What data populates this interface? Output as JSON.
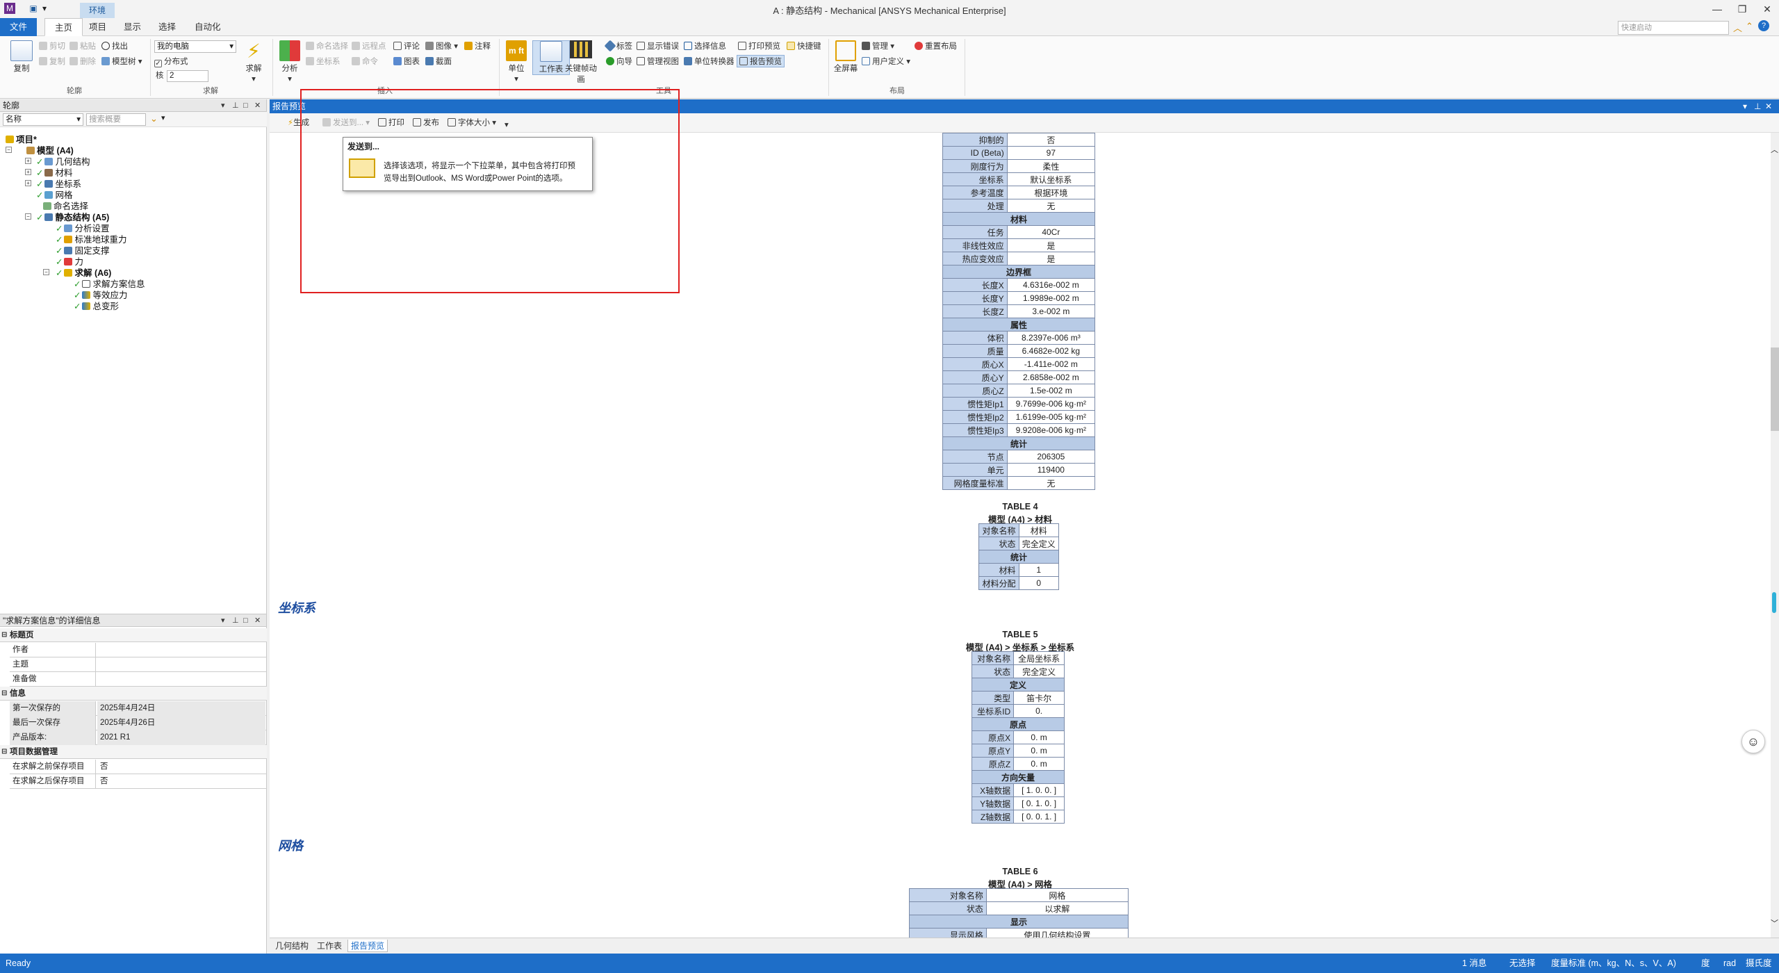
{
  "window": {
    "title": "A : 静态结构 - Mechanical [ANSYS Mechanical Enterprise]"
  },
  "tabs": {
    "env": "环境",
    "file": "文件",
    "items": [
      "主页",
      "项目",
      "显示",
      "选择",
      "自动化"
    ]
  },
  "quick_search": {
    "placeholder": "快速启动"
  },
  "ribbon": {
    "groups": [
      "轮廓",
      "求解",
      "插入",
      "工具",
      "布局"
    ],
    "outline": {
      "copy": "复制",
      "cut": "剪切",
      "paste": "粘贴",
      "find": "找出",
      "duplicate": "复制",
      "delete": "删除",
      "tree": "模型树"
    },
    "solve": {
      "target": "我的电脑",
      "distributed": "分布式",
      "cores_label": "核",
      "cores_value": "2",
      "solve_btn": "求解"
    },
    "insert": {
      "analysis": "分析",
      "named_sel": "命名选择",
      "coord": "坐标系",
      "remote": "远程点",
      "command": "命令",
      "comment": "评论",
      "chart": "图表",
      "image": "图像",
      "section": "截面",
      "annotation": "注释"
    },
    "tools": {
      "units": "单位",
      "worksheet": "工作表",
      "keyframe": "关键帧动画",
      "tag": "标签",
      "wizard": "向导",
      "show_errors": "显示错误",
      "manage_view": "管理视图",
      "sel_info": "选择信息",
      "unit_conv": "单位转换器",
      "print_preview": "打印预览",
      "report_preview": "报告预览",
      "shortcut": "快捷键"
    },
    "layout": {
      "fullscreen": "全屏幕",
      "manage": "管理",
      "user_def": "用户定义",
      "reset": "重置布局"
    }
  },
  "outline": {
    "title": "轮廓",
    "name_filter": "名称",
    "search_placeholder": "搜索概要",
    "tree": [
      {
        "label": "项目*"
      },
      {
        "label": "模型 (A4)"
      },
      {
        "label": "几何结构"
      },
      {
        "label": "材料"
      },
      {
        "label": "坐标系"
      },
      {
        "label": "网格"
      },
      {
        "label": "命名选择"
      },
      {
        "label": "静态结构 (A5)"
      },
      {
        "label": "分析设置"
      },
      {
        "label": "标准地球重力"
      },
      {
        "label": "固定支撑"
      },
      {
        "label": "力"
      },
      {
        "label": "求解 (A6)"
      },
      {
        "label": "求解方案信息"
      },
      {
        "label": "等效应力"
      },
      {
        "label": "总变形"
      }
    ]
  },
  "details": {
    "title": "\"求解方案信息\"的详细信息",
    "sections": [
      {
        "name": "标题页",
        "rows": [
          {
            "k": "作者",
            "v": ""
          },
          {
            "k": "主题",
            "v": ""
          },
          {
            "k": "准备做",
            "v": ""
          }
        ]
      },
      {
        "name": "信息",
        "rows": [
          {
            "k": "第一次保存的",
            "v": "2025年4月24日"
          },
          {
            "k": "最后一次保存",
            "v": "2025年4月26日"
          },
          {
            "k": "产品版本:",
            "v": "2021 R1"
          }
        ]
      },
      {
        "name": "项目数据管理",
        "rows": [
          {
            "k": "在求解之前保存项目",
            "v": "否"
          },
          {
            "k": "在求解之后保存项目",
            "v": "否"
          }
        ]
      }
    ]
  },
  "report": {
    "title": "报告预览",
    "toolbar": {
      "generate": "生成",
      "send": "发送到...",
      "print": "打印",
      "publish": "发布",
      "font": "字体大小"
    },
    "tooltip": {
      "title": "发送到...",
      "body_1": "选择该选项，将显示一个下拉菜单，其中包含将打印预",
      "body_2": "览导出到Outlook、MS Word或Power Point的选项。"
    },
    "table3": [
      {
        "k": "抑制的",
        "v": "否"
      },
      {
        "k": "ID (Beta)",
        "v": "97"
      },
      {
        "k": "刚度行为",
        "v": "柔性"
      },
      {
        "k": "坐标系",
        "v": "默认坐标系"
      },
      {
        "k": "参考温度",
        "v": "根据环境"
      },
      {
        "k": "处理",
        "v": "无"
      },
      {
        "sec": "材料"
      },
      {
        "k": "任务",
        "v": "40Cr"
      },
      {
        "k": "非线性效应",
        "v": "是"
      },
      {
        "k": "热应变效应",
        "v": "是"
      },
      {
        "sec": "边界框"
      },
      {
        "k": "长度X",
        "v": "4.6316e-002 m"
      },
      {
        "k": "长度Y",
        "v": "1.9989e-002 m"
      },
      {
        "k": "长度Z",
        "v": "3.e-002 m"
      },
      {
        "sec": "属性"
      },
      {
        "k": "体积",
        "v": "8.2397e-006 m³"
      },
      {
        "k": "质量",
        "v": "6.4682e-002 kg"
      },
      {
        "k": "质心X",
        "v": "-1.411e-002 m"
      },
      {
        "k": "质心Y",
        "v": "2.6858e-002 m"
      },
      {
        "k": "质心Z",
        "v": "1.5e-002 m"
      },
      {
        "k": "惯性矩Ip1",
        "v": "9.7699e-006 kg·m²"
      },
      {
        "k": "惯性矩Ip2",
        "v": "1.6199e-005 kg·m²"
      },
      {
        "k": "惯性矩Ip3",
        "v": "9.9208e-006 kg·m²"
      },
      {
        "sec": "统计"
      },
      {
        "k": "节点",
        "v": "206305"
      },
      {
        "k": "单元",
        "v": "119400"
      },
      {
        "k": "网格度量标准",
        "v": "无"
      }
    ],
    "table4": {
      "caption1": "TABLE 4",
      "caption2": "模型 (A4) > 材料",
      "rows": [
        {
          "k": "对象名称",
          "v": "材料"
        },
        {
          "k": "状态",
          "v": "完全定义"
        },
        {
          "sec": "统计"
        },
        {
          "k": "材料",
          "v": "1"
        },
        {
          "k": "材料分配",
          "v": "0"
        }
      ]
    },
    "sec_coord": "坐标系",
    "table5": {
      "caption1": "TABLE 5",
      "caption2": "模型 (A4) > 坐标系 > 坐标系",
      "rows": [
        {
          "k": "对象名称",
          "v": "全局坐标系"
        },
        {
          "k": "状态",
          "v": "完全定义"
        },
        {
          "sec": "定义"
        },
        {
          "k": "类型",
          "v": "笛卡尔"
        },
        {
          "k": "坐标系ID",
          "v": "0."
        },
        {
          "sec": "原点"
        },
        {
          "k": "原点X",
          "v": "0. m"
        },
        {
          "k": "原点Y",
          "v": "0. m"
        },
        {
          "k": "原点Z",
          "v": "0. m"
        },
        {
          "sec": "方向矢量"
        },
        {
          "k": "X轴数据",
          "v": "[ 1. 0. 0. ]"
        },
        {
          "k": "Y轴数据",
          "v": "[ 0. 1. 0. ]"
        },
        {
          "k": "Z轴数据",
          "v": "[ 0. 0. 1. ]"
        }
      ]
    },
    "sec_mesh": "网格",
    "table6": {
      "caption1": "TABLE 6",
      "caption2": "模型 (A4) > 网格",
      "rows": [
        {
          "k": "对象名称",
          "v": "网格"
        },
        {
          "k": "状态",
          "v": "以求解"
        },
        {
          "sec": "显示"
        },
        {
          "k": "显示风格",
          "v": "使用几何结构设置"
        }
      ]
    }
  },
  "bottom_tabs": [
    "几何结构",
    "工作表",
    "报告预览"
  ],
  "status": {
    "ready": "Ready",
    "messages": "1 消息",
    "selection": "无选择",
    "units": "度量标准 (m、kg、N、s、V、A)",
    "deg": "度",
    "rad": "rad",
    "temp": "摄氏度"
  }
}
